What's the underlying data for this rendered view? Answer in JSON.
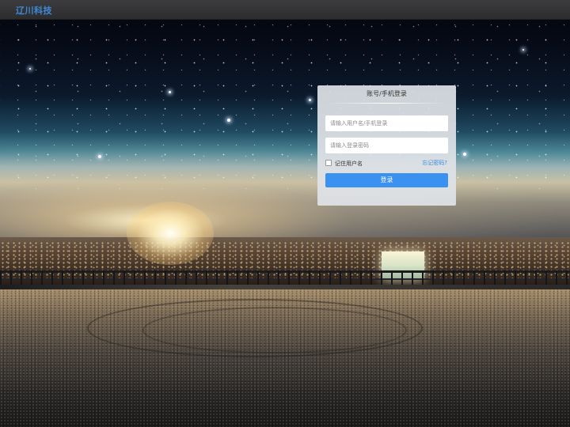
{
  "header": {
    "brand": "辽川科技"
  },
  "login": {
    "title": "账号/手机登录",
    "username_placeholder": "请输入用户名/手机登录",
    "password_placeholder": "请输入登录密码",
    "remember_label": "记住用户名",
    "remember_checked": false,
    "forgot_label": "忘记密码?",
    "submit_label": "登录"
  },
  "colors": {
    "brand": "#3d8bd8",
    "primary_button": "#3a91f0",
    "link": "#3d8bd8"
  }
}
